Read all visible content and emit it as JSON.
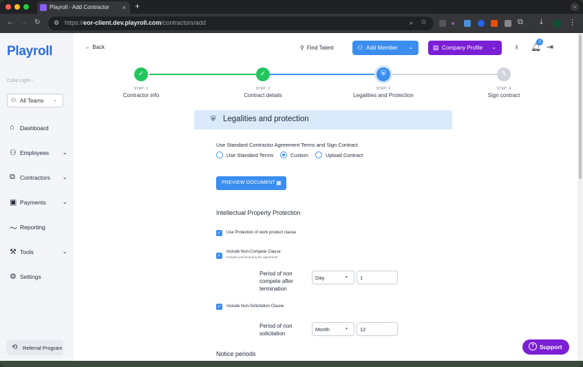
{
  "browser": {
    "tab_title": "Playroll - Add Contractor",
    "tab_close": "×",
    "new_tab": "+",
    "url_host": "eor-client.dev.playroll.com",
    "url_prefix": "https://",
    "url_path": "/contractors/add"
  },
  "sidebar": {
    "logo": "Playroll",
    "org_name": "Coke Light",
    "team_select": "All Teams",
    "items": [
      {
        "label": "Dashboard",
        "icon": "home-icon",
        "has_chevron": false
      },
      {
        "label": "Employees",
        "icon": "people-icon",
        "has_chevron": true
      },
      {
        "label": "Contractors",
        "icon": "contractors-icon",
        "has_chevron": true
      },
      {
        "label": "Payments",
        "icon": "payments-icon",
        "has_chevron": true
      },
      {
        "label": "Reporting",
        "icon": "chart-line-icon",
        "has_chevron": false
      },
      {
        "label": "Tools",
        "icon": "tools-icon",
        "has_chevron": true
      },
      {
        "label": "Settings",
        "icon": "gear-icon",
        "has_chevron": false
      }
    ],
    "referral": "Referral Program"
  },
  "header": {
    "back": "Back",
    "find_talent": "Find Talent",
    "add_member": "Add Member",
    "company_profile": "Company Profile",
    "notification_count": "3"
  },
  "stepper": {
    "steps": [
      {
        "label": "STEP: 1",
        "name": "Contractor info",
        "state": "done"
      },
      {
        "label": "STEP: 2",
        "name": "Contract details",
        "state": "done"
      },
      {
        "label": "STEP: 3",
        "name": "Legalities and Protection",
        "state": "active"
      },
      {
        "label": "STEP: 4",
        "name": "Sign contract",
        "state": "pending"
      }
    ]
  },
  "form": {
    "title": "Legalities and protection",
    "agreement_question": "Use Standard Contractor Agreement Terms and Sign Contract",
    "options": [
      {
        "label": "Use Standard Terms",
        "selected": false
      },
      {
        "label": "Custom",
        "selected": true
      },
      {
        "label": "Upload Contract",
        "selected": false
      }
    ],
    "preview_button": "PREVIEW DOCUMENT",
    "ip_section": "Intellectual Property Protection",
    "work_product": "Use Protection of work product clause",
    "non_compete": "Include Non-Compete Clause",
    "non_compete_hint": "Includes period during the agreement",
    "non_compete_period_label": "Period of non compete after termination",
    "non_compete_unit": "Day",
    "non_compete_value": "1",
    "non_solicitation": "Include Non-Solicitation Clause",
    "non_solicitation_period_label": "Period of non solicitation",
    "non_solicitation_unit": "Month",
    "non_solicitation_value": "12",
    "notice_section": "Notice periods"
  },
  "support": "Support",
  "colors": {
    "brand_blue": "#2d6cdf",
    "accent_blue": "#3b8ef0",
    "purple": "#7b1fd4",
    "success_green": "#22c55e",
    "pending_gray": "#d1d5db"
  }
}
